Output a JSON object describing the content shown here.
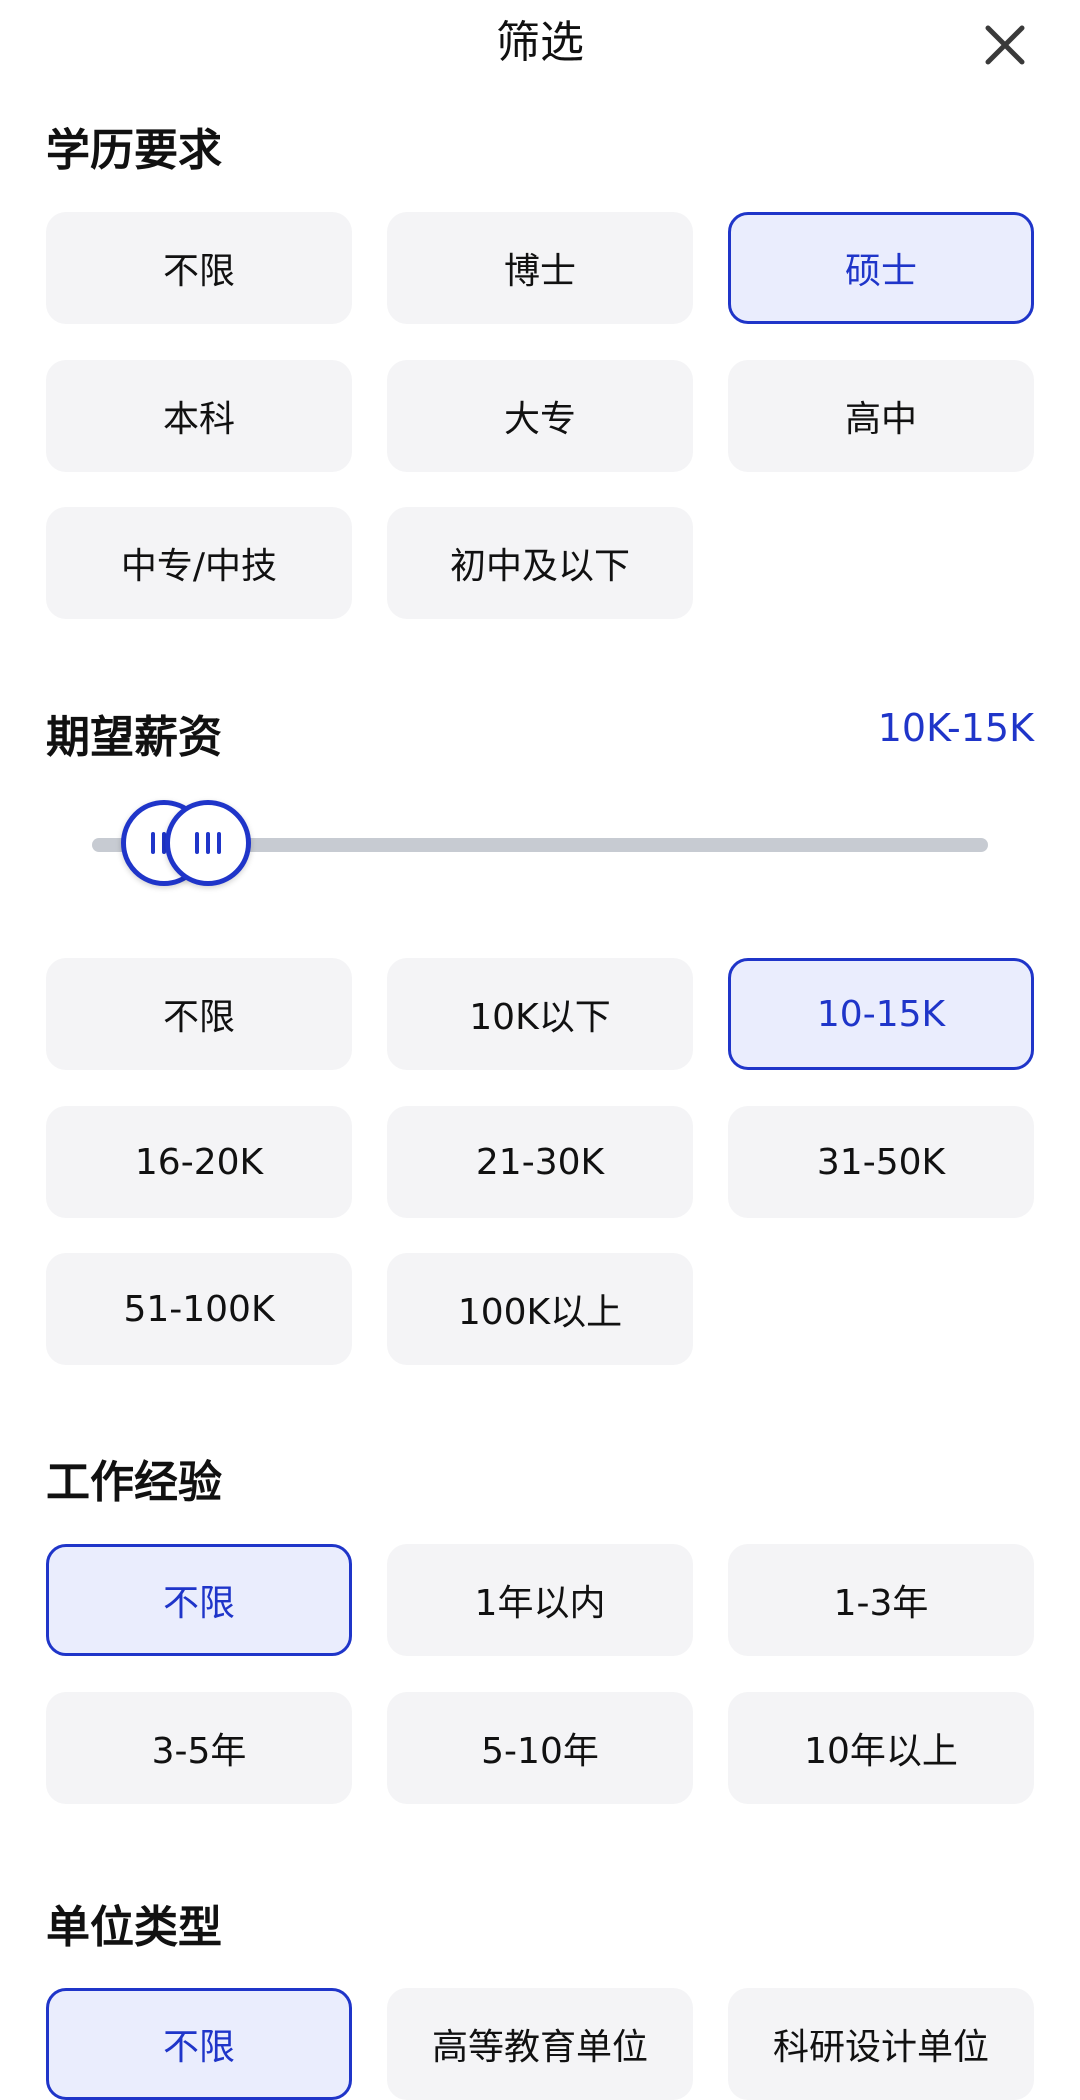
{
  "header": {
    "title": "筛选",
    "close_icon": "close-icon"
  },
  "education": {
    "title": "学历要求",
    "options": [
      "不限",
      "博士",
      "硕士",
      "本科",
      "大专",
      "高中",
      "中专/中技",
      "初中及以下"
    ],
    "selected": "硕士"
  },
  "salary": {
    "title": "期望薪资",
    "range_text": "10K-15K",
    "range_low_fraction": 0.08,
    "range_high_fraction": 0.13,
    "options": [
      "不限",
      "10K以下",
      "10-15K",
      "16-20K",
      "21-30K",
      "31-50K",
      "51-100K",
      "100K以上"
    ],
    "selected": "10-15K"
  },
  "experience": {
    "title": "工作经验",
    "options": [
      "不限",
      "1年以内",
      "1-3年",
      "3-5年",
      "5-10年",
      "10年以上"
    ],
    "selected": "不限"
  },
  "unit_type": {
    "title": "单位类型",
    "options": [
      "不限",
      "高等教育单位",
      "科研设计单位"
    ],
    "selected": "不限"
  },
  "colors": {
    "accent": "#1f35c9",
    "chip_bg": "#f4f4f6",
    "chip_selected_bg": "#eaedfd"
  }
}
